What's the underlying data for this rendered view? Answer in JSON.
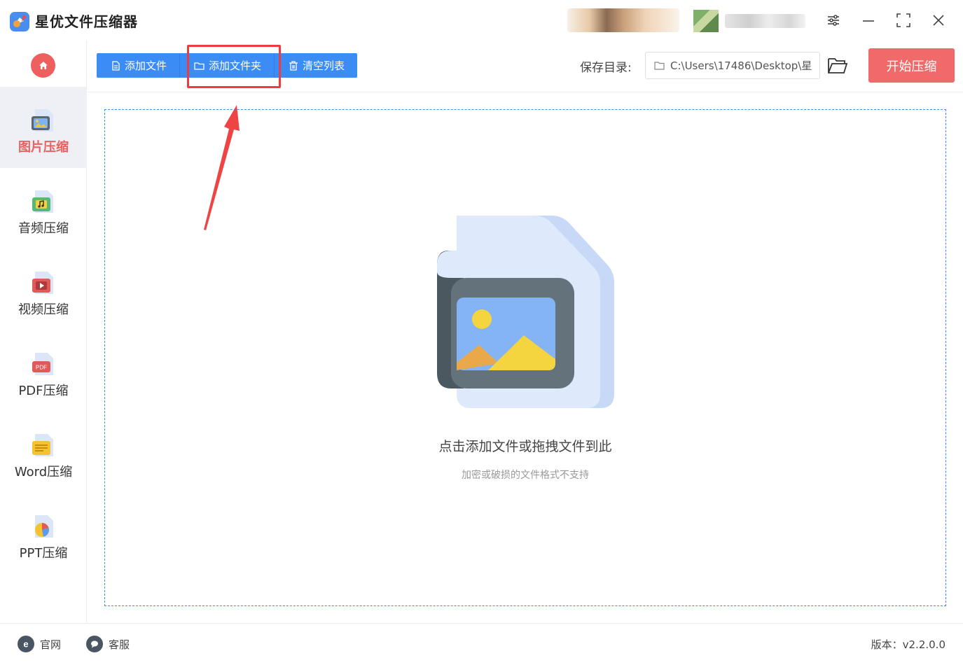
{
  "app": {
    "title": "星优文件压缩器"
  },
  "sidebar": {
    "items": [
      {
        "label": "图片压缩",
        "icon": "image-file-icon",
        "active": true
      },
      {
        "label": "音频压缩",
        "icon": "audio-file-icon",
        "active": false
      },
      {
        "label": "视频压缩",
        "icon": "video-file-icon",
        "active": false
      },
      {
        "label": "PDF压缩",
        "icon": "pdf-file-icon",
        "active": false
      },
      {
        "label": "Word压缩",
        "icon": "word-file-icon",
        "active": false
      },
      {
        "label": "PPT压缩",
        "icon": "ppt-file-icon",
        "active": false
      }
    ]
  },
  "toolbar": {
    "add_file": "添加文件",
    "add_folder": "添加文件夹",
    "clear_list": "清空列表",
    "save_label": "保存目录:",
    "save_path": "C:\\Users\\17486\\Desktop\\星",
    "start": "开始压缩"
  },
  "dropzone": {
    "title": "点击添加文件或拖拽文件到此",
    "subtitle": "加密或破损的文件格式不支持"
  },
  "footer": {
    "website": "官网",
    "support": "客服",
    "version": "版本：v2.2.0.0"
  },
  "colors": {
    "accent_blue": "#3b8cf5",
    "accent_red": "#ee5f5f",
    "start_button": "#f06a6a"
  }
}
